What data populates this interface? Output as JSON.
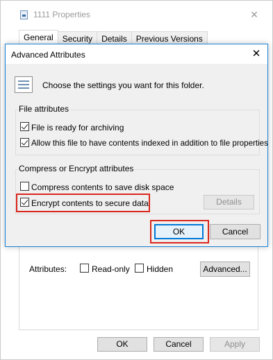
{
  "properties_window": {
    "title": "1111 Properties",
    "tabs": [
      "General",
      "Security",
      "Details",
      "Previous Versions"
    ],
    "attributes_label": "Attributes:",
    "read_only_label": "Read-only",
    "hidden_label": "Hidden",
    "advanced_button": "Advanced...",
    "ok_button": "OK",
    "cancel_button": "Cancel",
    "apply_button": "Apply"
  },
  "advanced_dialog": {
    "title": "Advanced Attributes",
    "intro": "Choose the settings you want for this folder.",
    "file_attributes": {
      "legend": "File attributes",
      "archiving_label": "File is ready for archiving",
      "archiving_checked": true,
      "indexed_label": "Allow this file to have contents indexed in addition to file properties",
      "indexed_checked": true
    },
    "compress_encrypt": {
      "legend": "Compress or Encrypt attributes",
      "compress_label": "Compress contents to save disk space",
      "compress_checked": false,
      "encrypt_label": "Encrypt contents to secure data",
      "encrypt_checked": true,
      "details_button": "Details"
    },
    "ok_button": "OK",
    "cancel_button": "Cancel"
  },
  "colors": {
    "highlight": "#d9261c",
    "dialog_border": "#1883d7",
    "focus_blue": "#0078d7"
  }
}
